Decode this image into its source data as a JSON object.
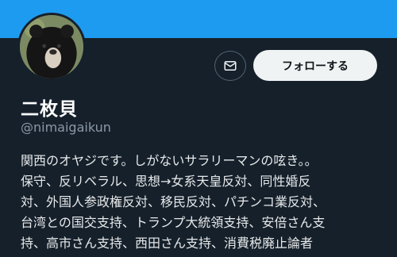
{
  "profile": {
    "display_name": "二枚貝",
    "handle": "@nimaigaikun",
    "bio_lines": [
      "関西のオヤジです。しがないサラリーマンの呟き。。",
      "保守、反リベラル、思想→女系天皇反対、同性婚反",
      "対、外国人参政権反対、移民反対、パチンコ業反対、",
      "台湾との国交支持、トランプ大統領支持、安倍さん支",
      "持、高市さん支持、西田さん支持、消費税廃止論者"
    ]
  },
  "actions": {
    "follow_label": "フォローする",
    "message_icon": "mail-icon"
  },
  "colors": {
    "banner": "#1d9bf0",
    "background": "#15202b",
    "secondary_text": "#8b98a5"
  }
}
